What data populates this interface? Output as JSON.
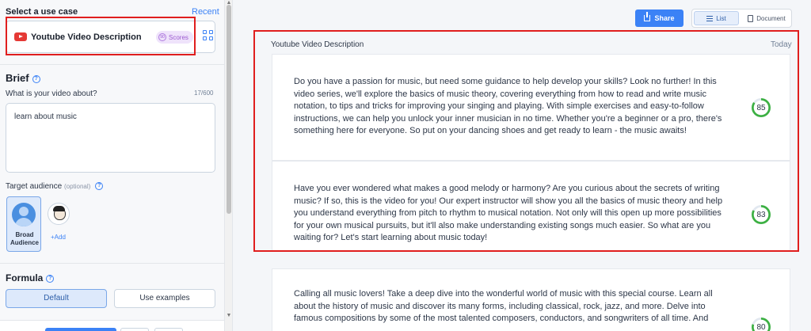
{
  "left_panel": {
    "use_case_label": "Select a use case",
    "recent_link": "Recent",
    "selected_use_case": {
      "name": "Youtube Video Description",
      "icon": "youtube-icon",
      "badge": "Scores"
    },
    "brief": {
      "title": "Brief",
      "question": "What is your video about?",
      "counter": "17/600",
      "value": "learn about music"
    },
    "target_audience": {
      "label": "Target audience",
      "optional": "(optional)",
      "selected_card": "Broad Audience",
      "add_label": "+Add"
    },
    "formula": {
      "title": "Formula",
      "options": [
        "Default",
        "Use examples"
      ],
      "selected": "Default"
    }
  },
  "toolbar": {
    "share_label": "Share",
    "view_options": [
      "List",
      "Document"
    ],
    "selected_view": "List"
  },
  "results": {
    "title": "Youtube Video Description",
    "date": "Today",
    "items": [
      {
        "text": "Do you have a passion for music, but need some guidance to help develop your skills? Look no further! In this video series, we'll explore the basics of music theory, covering everything from how to read and write music notation, to tips and tricks for improving your singing and playing. With simple exercises and easy-to-follow instructions, we can help you unlock your inner musician in no time. Whether you're a beginner or a pro, there's something here for everyone. So put on your dancing shoes and get ready to learn - the music awaits!",
        "score": "85"
      },
      {
        "text": "Have you ever wondered what makes a good melody or harmony? Are you curious about the secrets of writing music? If so, this is the video for you! Our expert instructor will show you all the basics of music theory and help you understand everything from pitch to rhythm to musical notation. Not only will this open up more possibilities for your own musical pursuits, but it'll also make understanding existing songs much easier. So what are you waiting for? Let's start learning about music today!",
        "score": "83"
      },
      {
        "text": "Calling all music lovers! Take a deep dive into the wonderful world of music with this special course. Learn all about the history of music and discover its many forms, including classical, rock, jazz, and more. Delve into famous compositions by some of the most talented composers, conductors, and songwriters of all time. And",
        "score": "80"
      }
    ]
  },
  "colors": {
    "accent": "#3b82f6",
    "highlight_box": "#e01e1e",
    "score_green": "#3cb043",
    "youtube_red": "#e53935"
  }
}
